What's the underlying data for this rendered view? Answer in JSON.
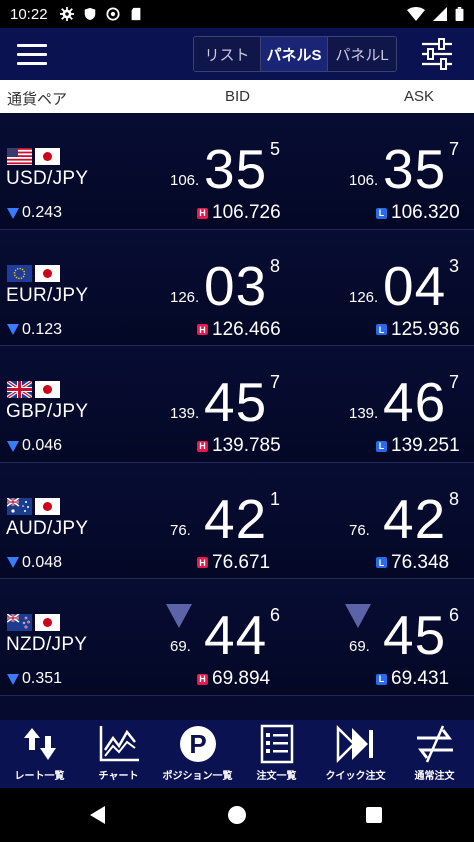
{
  "status_bar": {
    "time": "10:22",
    "left_icons": [
      "gear-icon",
      "shield-icon",
      "at-sign-icon",
      "sd-card-icon"
    ],
    "right_icons": [
      "wifi-icon",
      "signal-icon",
      "battery-icon"
    ]
  },
  "header": {
    "tabs": [
      {
        "label": "リスト",
        "active": false
      },
      {
        "label": "パネルS",
        "active": true
      },
      {
        "label": "パネルL",
        "active": false
      }
    ]
  },
  "columns": {
    "pair": "通貨ペア",
    "bid": "BID",
    "ask": "ASK"
  },
  "rows": [
    {
      "pair": "USD/JPY",
      "flags": [
        "us",
        "jp"
      ],
      "change": "0.243",
      "direction": "down",
      "bid": {
        "prefix": "106.",
        "big": "35",
        "pip": "5"
      },
      "ask": {
        "prefix": "106.",
        "big": "35",
        "pip": "7"
      },
      "high": "106.726",
      "low": "106.320",
      "tick_down": false
    },
    {
      "pair": "EUR/JPY",
      "flags": [
        "eu",
        "jp"
      ],
      "change": "0.123",
      "direction": "down",
      "bid": {
        "prefix": "126.",
        "big": "03",
        "pip": "8"
      },
      "ask": {
        "prefix": "126.",
        "big": "04",
        "pip": "3"
      },
      "high": "126.466",
      "low": "125.936",
      "tick_down": false
    },
    {
      "pair": "GBP/JPY",
      "flags": [
        "gb",
        "jp"
      ],
      "change": "0.046",
      "direction": "down",
      "bid": {
        "prefix": "139.",
        "big": "45",
        "pip": "7"
      },
      "ask": {
        "prefix": "139.",
        "big": "46",
        "pip": "7"
      },
      "high": "139.785",
      "low": "139.251",
      "tick_down": false
    },
    {
      "pair": "AUD/JPY",
      "flags": [
        "au",
        "jp"
      ],
      "change": "0.048",
      "direction": "down",
      "bid": {
        "prefix": "76.",
        "big": "42",
        "pip": "1"
      },
      "ask": {
        "prefix": "76.",
        "big": "42",
        "pip": "8"
      },
      "high": "76.671",
      "low": "76.348",
      "tick_down": false
    },
    {
      "pair": "NZD/JPY",
      "flags": [
        "nz",
        "jp"
      ],
      "change": "0.351",
      "direction": "down",
      "bid": {
        "prefix": "69.",
        "big": "44",
        "pip": "6"
      },
      "ask": {
        "prefix": "69.",
        "big": "45",
        "pip": "6"
      },
      "high": "69.894",
      "low": "69.431",
      "tick_down": true
    }
  ],
  "bottom_nav": [
    {
      "label": "レート一覧",
      "icon": "arrows-updown-icon"
    },
    {
      "label": "チャート",
      "icon": "chart-icon"
    },
    {
      "label": "ポジション一覧",
      "icon": "position-p-icon"
    },
    {
      "label": "注文一覧",
      "icon": "order-list-icon"
    },
    {
      "label": "クイック注文",
      "icon": "quick-order-icon"
    },
    {
      "label": "通常注文",
      "icon": "normal-order-icon"
    }
  ],
  "colors": {
    "appbar": "#0b1252",
    "list_bg": "#050a2e",
    "high_badge": "#e8194a",
    "low_badge": "#2a6be8",
    "change_arrow": "#3a7cff"
  },
  "badges": {
    "high": "H",
    "low": "L"
  }
}
